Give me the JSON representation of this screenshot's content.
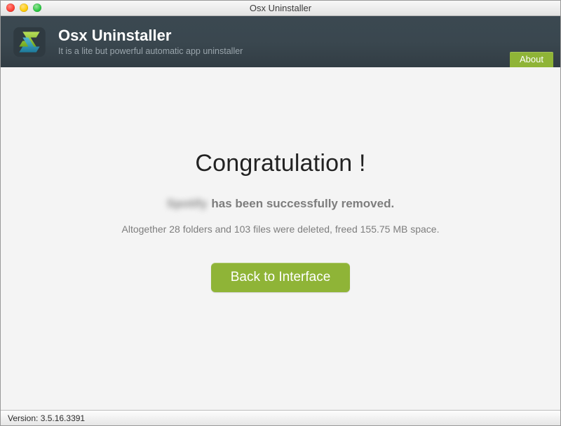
{
  "window": {
    "title": "Osx Uninstaller"
  },
  "header": {
    "app_title": "Osx Uninstaller",
    "subtitle": "It is a lite but powerful automatic app uninstaller",
    "about_label": "About"
  },
  "main": {
    "heading": "Congratulation !",
    "removed_app_name": "Spotify",
    "removed_suffix": "has been successfully removed.",
    "detail": "Altogether 28 folders and 103 files were deleted, freed 155.75 MB space.",
    "back_label": "Back to Interface"
  },
  "footer": {
    "version_label": "Version: 3.5.16.3391"
  },
  "stats": {
    "folders_deleted": 28,
    "files_deleted": 103,
    "freed_space": "155.75 MB"
  },
  "colors": {
    "accent": "#8fb437",
    "header_bg": "#3a474f"
  }
}
